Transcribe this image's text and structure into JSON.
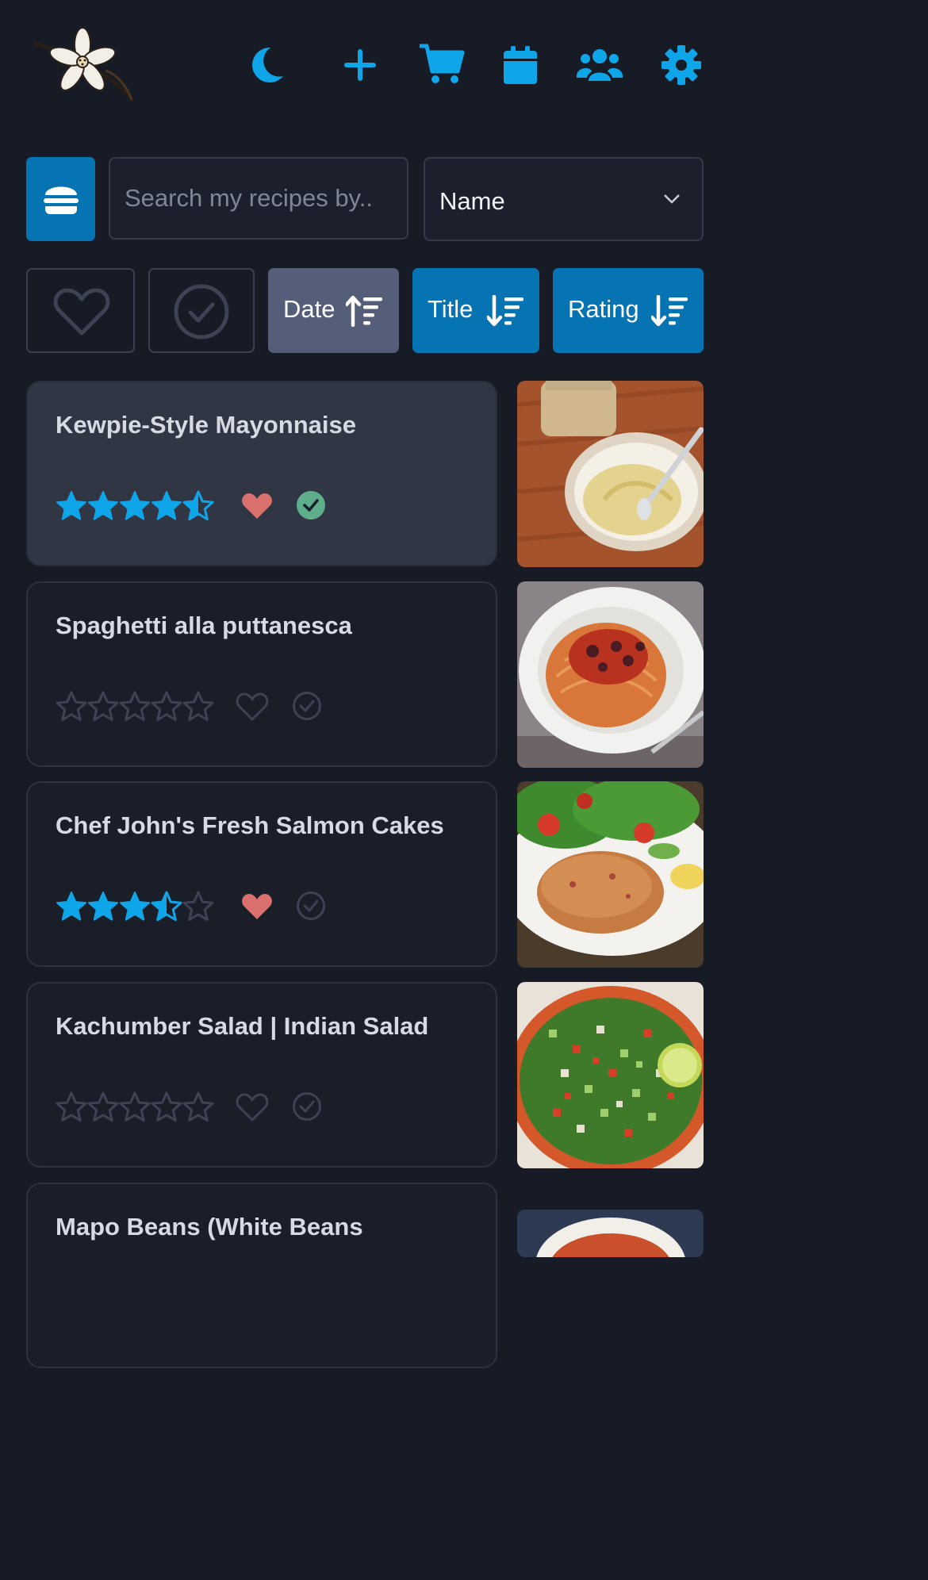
{
  "header": {
    "logo": "vanilla-flower-logo",
    "icons": [
      "moon-icon",
      "plus-icon",
      "cart-icon",
      "calendar-icon",
      "users-icon",
      "gear-icon"
    ],
    "accent": "#0ea5e9"
  },
  "search": {
    "category_icon": "burger-icon",
    "placeholder": "Search my recipes by..",
    "sort_field": "Name"
  },
  "filters": {
    "favorite_icon": "heart-icon",
    "cooked_icon": "check-circle-icon",
    "sort_buttons": [
      {
        "label": "Date",
        "direction": "ascending",
        "active": false
      },
      {
        "label": "Title",
        "direction": "descending",
        "active": true
      },
      {
        "label": "Rating",
        "direction": "descending",
        "active": true
      }
    ]
  },
  "recipes": [
    {
      "title": "Kewpie-Style Mayonnaise",
      "rating": 4.5,
      "favorite": true,
      "cooked": true,
      "image": "mayonnaise-bowl-photo"
    },
    {
      "title": "Spaghetti alla puttanesca",
      "rating": 0,
      "favorite": false,
      "cooked": false,
      "image": "spaghetti-plate-photo"
    },
    {
      "title": "Chef John's Fresh Salmon Cakes",
      "rating": 3.5,
      "favorite": true,
      "cooked": false,
      "image": "salmon-cake-photo"
    },
    {
      "title": "Kachumber Salad | Indian Salad",
      "rating": 0,
      "favorite": false,
      "cooked": false,
      "image": "kachumber-salad-photo"
    },
    {
      "title": "Mapo Beans (White Beans",
      "image": "mapo-beans-photo"
    }
  ],
  "colors": {
    "background": "#171b26",
    "star": "#0ea5e9",
    "heart": "#d9706d",
    "check": "#5eae8c",
    "sort_active": "#0673b3",
    "sort_inactive": "#545e78"
  }
}
